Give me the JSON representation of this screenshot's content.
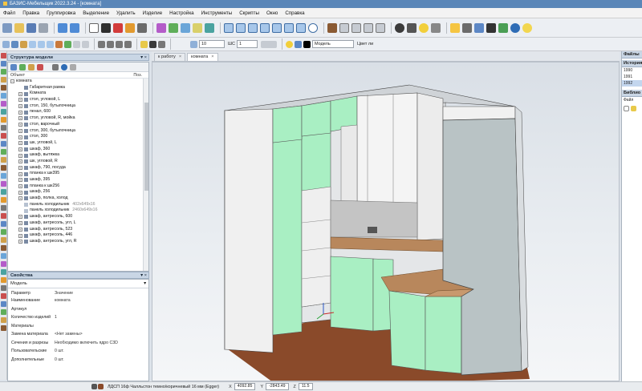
{
  "app": {
    "title": "БАЗИС-Мебельщик 2022.3.24 - [комната]"
  },
  "menu": [
    "Файл",
    "Правка",
    "Группировка",
    "Выделение",
    "Удалить",
    "Изделие",
    "Настройка",
    "Инструменты",
    "Скрипты",
    "Окно",
    "Справка"
  ],
  "toolbar2": {
    "thickness_value": "10",
    "ms_label": "ШС",
    "ms_value": "1",
    "layer_value": "Модель",
    "color_label": "Цвет ли"
  },
  "left_panel": {
    "title": "Структура модели",
    "col_object": "Объект",
    "col_pos": "Поз.",
    "root": "комната",
    "nodes": [
      {
        "label": "Габаритная рамка",
        "expand": false,
        "extra": ""
      },
      {
        "label": "Комната",
        "expand": true,
        "extra": ""
      },
      {
        "label": "стол, угловой, L",
        "expand": true,
        "extra": ""
      },
      {
        "label": "стол, 150, бутылочница",
        "expand": true,
        "extra": ""
      },
      {
        "label": "пенал, 600",
        "expand": true,
        "extra": ""
      },
      {
        "label": "стол, угловой, R, мойка",
        "expand": true,
        "extra": ""
      },
      {
        "label": "стол, варочный",
        "expand": true,
        "extra": ""
      },
      {
        "label": "стол, 300, бутылочница",
        "expand": true,
        "extra": ""
      },
      {
        "label": "стол, 300",
        "expand": true,
        "extra": ""
      },
      {
        "label": "шк, угловой, L",
        "expand": true,
        "extra": ""
      },
      {
        "label": "шкаф, 360",
        "expand": true,
        "extra": ""
      },
      {
        "label": "шкаф, вытяжка",
        "expand": true,
        "extra": ""
      },
      {
        "label": "шк, угловой, R",
        "expand": true,
        "extra": ""
      },
      {
        "label": "шкаф, 790, посуда",
        "expand": true,
        "extra": ""
      },
      {
        "label": "планка к шк395",
        "expand": true,
        "extra": ""
      },
      {
        "label": "шкаф, 395",
        "expand": true,
        "extra": ""
      },
      {
        "label": "планка к шк256",
        "expand": true,
        "extra": ""
      },
      {
        "label": "шкаф, 256",
        "expand": true,
        "extra": ""
      },
      {
        "label": "шкаф, полка, холод",
        "expand": true,
        "extra": ""
      },
      {
        "label": "панель холодильник",
        "expand": false,
        "extra": "402x649x16"
      },
      {
        "label": "панель холодильник",
        "expand": false,
        "extra": "2460x649x16"
      },
      {
        "label": "шкаф, антресоль, 600",
        "expand": true,
        "extra": ""
      },
      {
        "label": "шкаф, антресоль, угл, L",
        "expand": true,
        "extra": ""
      },
      {
        "label": "шкаф, антресоль, 523",
        "expand": true,
        "extra": ""
      },
      {
        "label": "шкаф, антресоль, 446",
        "expand": true,
        "extra": ""
      },
      {
        "label": "шкаф, антресоль, угл, R",
        "expand": true,
        "extra": ""
      }
    ]
  },
  "props_panel": {
    "title": "Свойства",
    "selector": "Модель",
    "col_param": "Параметр",
    "col_value": "Значение",
    "rows": [
      {
        "k": "Наименование",
        "v": "комната"
      },
      {
        "k": "Артикул",
        "v": ""
      },
      {
        "k": "Количество изделий",
        "v": "1"
      },
      {
        "k": "Материалы",
        "v": ""
      },
      {
        "k": "Замена материала",
        "v": "<Нет замены>"
      },
      {
        "k": "Сечения и разрезы",
        "v": "Необходимо включить ядро C3D"
      },
      {
        "k": "Пользовательские",
        "v": "0 шт."
      },
      {
        "k": "Дополнительные",
        "v": "0 шт."
      }
    ]
  },
  "tabs": [
    {
      "label": "к работу",
      "active": false
    },
    {
      "label": "комната",
      "active": true
    }
  ],
  "right_panel": {
    "files_title": "Файлы",
    "history_title": "История",
    "history": [
      "1990",
      "1991",
      "1992"
    ],
    "library_title": "Библио",
    "library_sub": "Файл"
  },
  "status": {
    "material": "ЛДСП 16ф Чалльстон темно/коричневый 16 мм (Egger)",
    "x_label": "X",
    "x_value": "4092.85",
    "y_label": "Y",
    "y_value": "-2843.49",
    "z_label": "Z",
    "z_value": "11.5"
  },
  "colors": {
    "facade": "#a9efc3",
    "carcass": "#f0f0f0",
    "wall": "#b9c3c5",
    "counter": "#b8875c",
    "floor": "#8a4a2a",
    "backsplash": "#c4c4c4"
  }
}
